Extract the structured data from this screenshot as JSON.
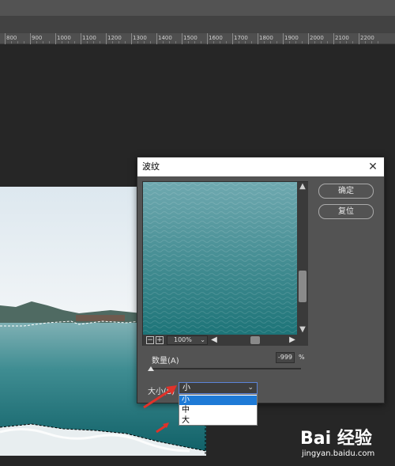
{
  "ruler": {
    "labels": [
      "800",
      "900",
      "1000",
      "1100",
      "1200",
      "1300",
      "1400",
      "1500",
      "1600",
      "1700",
      "1800",
      "1900",
      "2000",
      "2100",
      "2200"
    ]
  },
  "dialog": {
    "title": "波纹",
    "close_icon": "close-icon",
    "ok_label": "确定",
    "reset_label": "复位",
    "zoom_value": "100%",
    "amount_label": "数量(A)",
    "amount_value": "-999",
    "amount_unit": "%",
    "amount_level": 0,
    "size_label": "大小(S)",
    "size_selected": "小",
    "size_options": [
      "小",
      "中",
      "大"
    ]
  },
  "colors": {
    "dialog_bg": "#535353",
    "accent_select": "#1e7ad6",
    "arrow_red": "#e0322a",
    "water_teal": "#2a8a8e"
  },
  "watermark": {
    "logo": "Bai 经验",
    "site": "jingyan.baidu.com"
  }
}
